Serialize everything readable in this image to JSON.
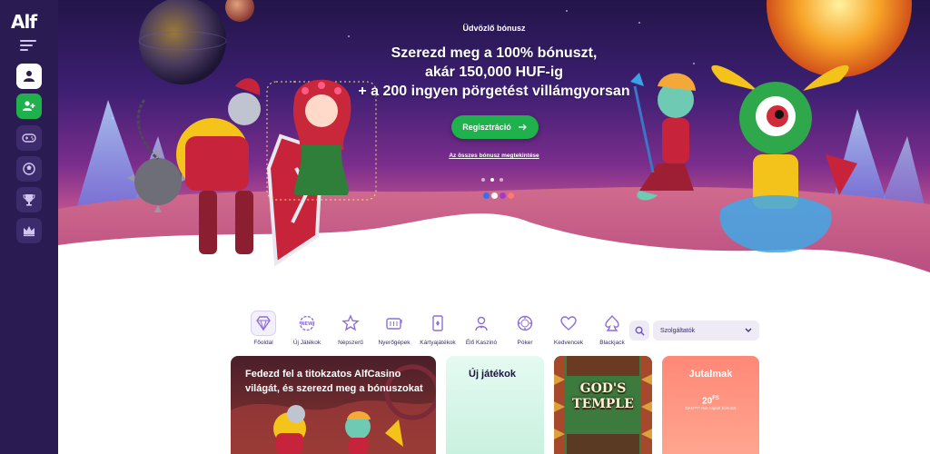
{
  "app": {
    "logo_text": "Alf",
    "brand_color": "#2a1b52",
    "accent_color": "#1fb14b"
  },
  "sidebar": {
    "items": [
      {
        "icon": "user-icon",
        "style": "white"
      },
      {
        "icon": "user-add-icon",
        "style": "green"
      },
      {
        "icon": "gamepad-icon",
        "style": "default"
      },
      {
        "icon": "sports-ball-icon",
        "style": "default"
      },
      {
        "icon": "trophy-icon",
        "style": "default"
      },
      {
        "icon": "crown-icon",
        "style": "default"
      }
    ]
  },
  "hero": {
    "welcome": "Üdvözlő bónusz",
    "headline_1": "Szerezd meg a 100% bónuszt,",
    "headline_2": "akár 150,000 HUF-ig",
    "headline_3": "+ a 200 ingyen pörgetést villámgyorsan",
    "register_button": "Regisztráció",
    "all_bonus_link": "Az összes bónusz megtekintése",
    "slide_count": 3,
    "active_slide": 2
  },
  "categories": [
    {
      "label": "Főoldal",
      "icon": "diamond-icon",
      "active": true
    },
    {
      "label": "Új Játékok",
      "icon": "new-badge-icon",
      "active": false
    },
    {
      "label": "Népszerű",
      "icon": "star-icon",
      "active": false
    },
    {
      "label": "Nyerőgépek",
      "icon": "slot-machine-icon",
      "active": false
    },
    {
      "label": "Kártyajátékok",
      "icon": "playing-card-icon",
      "active": false
    },
    {
      "label": "Élő Kaszinó",
      "icon": "dealer-icon",
      "active": false
    },
    {
      "label": "Póker",
      "icon": "poker-chip-icon",
      "active": false
    },
    {
      "label": "Kedvencek",
      "icon": "heart-icon",
      "active": false
    },
    {
      "label": "Blackjack",
      "icon": "spade-icon",
      "active": false
    }
  ],
  "filter": {
    "provider_select": "Szolgáltatók"
  },
  "cards": {
    "promo_title": "Fedezd fel a titokzatos AlfCasino világát, és szerezd meg a bónuszokat",
    "new_games_title": "Új játékok",
    "game_title_line1": "GOD'S",
    "game_title_line2": "TEMPLE",
    "rewards_title": "Jutalmak",
    "rewards_value": "20",
    "rewards_unit": "FS",
    "rewards_small": "DAN**** már kapott bónuszt"
  }
}
